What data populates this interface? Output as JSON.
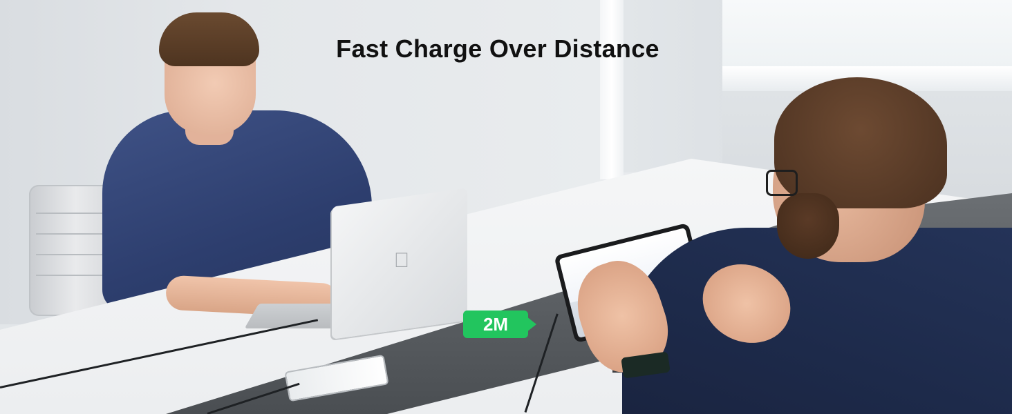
{
  "headline": "Fast Charge Over Distance",
  "cable_badge": {
    "label": "2M",
    "color": "#22c55e"
  },
  "colors": {
    "headline_text": "#111111",
    "badge_text": "#ffffff"
  }
}
